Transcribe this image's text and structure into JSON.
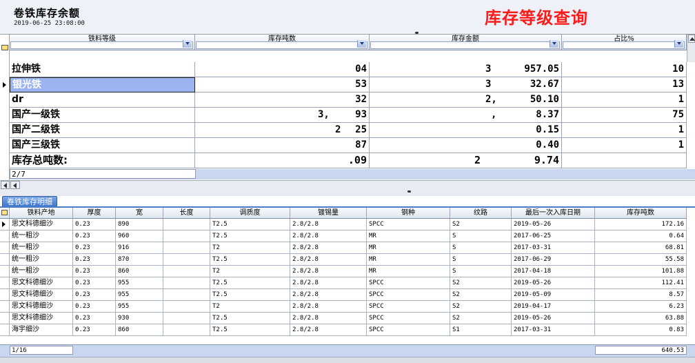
{
  "header": {
    "title": "卷铁库存余额",
    "datetime": "2019-06-25 23:08:00",
    "query_title": "库存等级查询"
  },
  "grade_grid": {
    "columns": [
      "铁料等级",
      "库存吨数",
      "库存金额",
      "占比%"
    ],
    "rows": [
      {
        "grade": "拉伸铁",
        "tons": "04",
        "amount_a": "3",
        "amount_b": "957.05",
        "pct": "10"
      },
      {
        "grade": "银光铁",
        "tons": "53",
        "amount_a": "3",
        "amount_b": "32.67",
        "pct": "13",
        "selected": true
      },
      {
        "grade": "dr",
        "tons": "32",
        "amount_a": "2,",
        "amount_b": "50.10",
        "pct": "1"
      },
      {
        "grade": "国产一级铁",
        "tons_a": "3,",
        "tons": "93",
        "amount_a": ",",
        "amount_b": "8.37",
        "pct": "75"
      },
      {
        "grade": "国产二级铁",
        "tons_a": "2",
        "tons": "25",
        "amount_a": "",
        "amount_b": "0.15",
        "pct": "1"
      },
      {
        "grade": "国产三级铁",
        "tons": "87",
        "amount_a": "",
        "amount_b": "0.40",
        "pct": "1"
      }
    ],
    "total_label": "库存总吨数:",
    "total_tons": ".09",
    "total_amount_a": "2",
    "total_amount_b": "9.74",
    "position": "2/7"
  },
  "detail_tab": {
    "label": "卷铁库存明细"
  },
  "detail_grid": {
    "columns": [
      "铁料产地",
      "厚度",
      "宽",
      "长度",
      "调质度",
      "镀锡量",
      "钢种",
      "纹路",
      "最后一次入库日期",
      "库存吨数"
    ],
    "rows": [
      [
        "思文科德细沙",
        "0.23",
        "890",
        "",
        "T2.5",
        "2.8/2.8",
        "SPCC",
        "S2",
        "2019-05-26",
        "172.16"
      ],
      [
        "统一粗沙",
        "0.23",
        "960",
        "",
        "T2.5",
        "2.8/2.8",
        "MR",
        "S",
        "2017-06-25",
        "0.64"
      ],
      [
        "统一粗沙",
        "0.23",
        "916",
        "",
        "T2",
        "2.8/2.8",
        "MR",
        "S",
        "2017-03-31",
        "68.81"
      ],
      [
        "统一粗沙",
        "0.23",
        "870",
        "",
        "T2.5",
        "2.8/2.8",
        "MR",
        "S",
        "2017-06-29",
        "55.58"
      ],
      [
        "统一粗沙",
        "0.23",
        "860",
        "",
        "T2",
        "2.8/2.8",
        "MR",
        "S",
        "2017-04-18",
        "101.88"
      ],
      [
        "思文科德细沙",
        "0.23",
        "955",
        "",
        "T2.5",
        "2.8/2.8",
        "SPCC",
        "S2",
        "2019-05-26",
        "112.41"
      ],
      [
        "思文科德细沙",
        "0.23",
        "955",
        "",
        "T2.5",
        "2.8/2.8",
        "SPCC",
        "S2",
        "2019-05-09",
        "8.57"
      ],
      [
        "思文科德细沙",
        "0.23",
        "955",
        "",
        "T2",
        "2.8/2.8",
        "SPCC",
        "S2",
        "2019-04-17",
        "6.23"
      ],
      [
        "思文科德细沙",
        "0.23",
        "930",
        "",
        "T2.5",
        "2.8/2.8",
        "SPCC",
        "S2",
        "2019-05-26",
        "63.88"
      ],
      [
        "海宇细沙",
        "0.23",
        "860",
        "",
        "T2.5",
        "2.8/2.8",
        "SPCC",
        "S1",
        "2017-03-31",
        "0.83"
      ]
    ],
    "position": "1/16",
    "total_tons": "640.53"
  }
}
